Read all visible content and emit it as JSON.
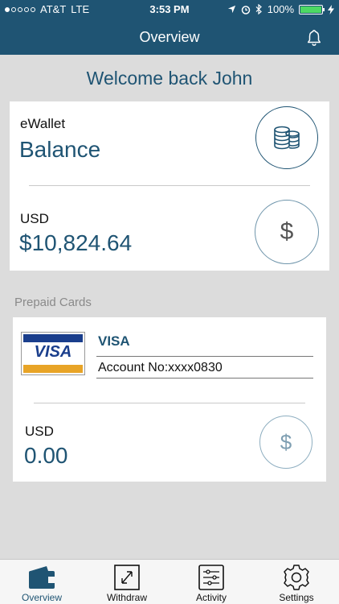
{
  "status": {
    "carrier": "AT&T",
    "network": "LTE",
    "time": "3:53 PM",
    "battery": "100%",
    "battery_fill": 1.0
  },
  "nav": {
    "title": "Overview",
    "bell_icon": "bell-icon"
  },
  "welcome": "Welcome back John",
  "wallet": {
    "label": "eWallet",
    "title": "Balance",
    "coins_icon": "coins-icon",
    "currency": "USD",
    "amount": "$10,824.64",
    "dollar_glyph": "$"
  },
  "prepaid": {
    "section_label": "Prepaid Cards",
    "card_brand": "VISA",
    "logo_text": "VISA",
    "account": "Account No:xxxx0830",
    "currency": "USD",
    "amount": "0.00",
    "dollar_glyph": "$"
  },
  "tabs": [
    {
      "label": "Overview",
      "icon": "wallet-icon",
      "active": true
    },
    {
      "label": "Withdraw",
      "icon": "withdraw-icon",
      "active": false
    },
    {
      "label": "Activity",
      "icon": "activity-icon",
      "active": false
    },
    {
      "label": "Settings",
      "icon": "gear-icon",
      "active": false
    }
  ],
  "colors": {
    "brand": "#1f5473",
    "background": "#dcdcdc",
    "battery": "#4cd964",
    "visa_blue": "#1a3e8c",
    "visa_gold": "#e8a427"
  }
}
